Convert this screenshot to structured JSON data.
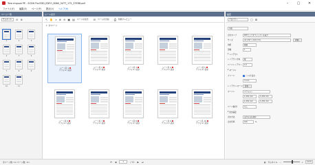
{
  "window": {
    "title": "Tero rmpuze PE - ECDH Flo:EDD_EDFO_6060_54T7_175_37ER8.pdf",
    "controls": [
      "–",
      "▢",
      "✕"
    ]
  },
  "menu": [
    "ファイル(F)",
    "編集(E)",
    "ページ(P)",
    "表示(V)",
    "ヘルプ(H)"
  ],
  "left_pane": {
    "header": "ページ一覧",
    "dropdown": "サムネイル",
    "thumbnails": [
      {
        "num": "1"
      },
      {
        "num": "2"
      },
      {
        "num": "3"
      },
      {
        "num": "4"
      },
      {
        "num": "5"
      },
      {
        "num": "6"
      },
      {
        "num": "7"
      },
      {
        "num": "8"
      },
      {
        "num": "9"
      },
      {
        "num": "10"
      },
      {
        "num": "11"
      }
    ]
  },
  "center_pane": {
    "header": "シート表示",
    "toolbar": [
      "ページの表示",
      "ページの分割",
      "印刷プレビュー"
    ],
    "section_label": "全1ページ",
    "pages": [
      {
        "label": "シート名 1",
        "sub": "デフォルト表示"
      },
      {
        "label": "シート名 2",
        "sub": "デフォルト表示"
      },
      {
        "label": "シート名 3",
        "sub": "デフォルト表示"
      },
      {
        "label": "シート名 4",
        "sub": "デフォルト表示"
      },
      {
        "label": "シート名 5",
        "sub": "デフォルト表示"
      },
      {
        "label": "シート名 6",
        "sub": "デフォルト表示"
      },
      {
        "label": "シート名 7",
        "sub": "デフォルト表示"
      },
      {
        "label": "シート名 8",
        "sub": "デフォルト表示"
      },
      {
        "label": "シート名 9",
        "sub": "デフォルト表示"
      },
      {
        "label": "シート名 10",
        "sub": "デフォルト表示"
      }
    ]
  },
  "right_pane": {
    "header": "設定",
    "toolbar_dropdown": "プロパティ",
    "general_dropdown": "全般",
    "fields": {
      "output_type_label": "出力タイプ",
      "output_type_value": "PDFとしてオブジェクトを出力",
      "size_label": "サイズ",
      "size_value": "A4 (297 x 420 mm)",
      "size_button": "詳細...",
      "orientation_label": "用紙",
      "orientation_value": "縦横",
      "copies_label": "部数",
      "copies_value": "1"
    },
    "layout_section": "レイアウト",
    "layout_items": [
      {
        "label": "レイアウト方向",
        "value": "縦"
      },
      {
        "label": "ページレイアウト",
        "value": "1/1"
      }
    ],
    "margin_section": "マージン",
    "margins": {
      "bleed_label": "ブリード",
      "bleed_check": "トンボ 表示",
      "bleed_value": "3 mm",
      "pos_label": "レイアウト/マージン",
      "pos_button": "変更...",
      "margin_label": "マージン",
      "margin_value": "デフォルト",
      "top": "1,250 mm",
      "bottom": "1,250 mm",
      "left": "1,250 mm",
      "right": "1,250 mm",
      "page_cols_label": "ページ数/列",
      "page_cols_value": "なし"
    },
    "output_section": "出力設定",
    "output": {
      "method_label": "出力方法",
      "method_value": "出力方法を選択",
      "scale_label": "出力倍率",
      "scale_value": "100",
      "scale_unit": "%"
    }
  },
  "statusbar": {
    "left": "全ページ数: 11 (ページ数: 11)",
    "current_page": "1",
    "total_pages": "/ 11",
    "right_label": "サムネイル",
    "zoom": "100%",
    "zoom_fraction": 0.55
  }
}
